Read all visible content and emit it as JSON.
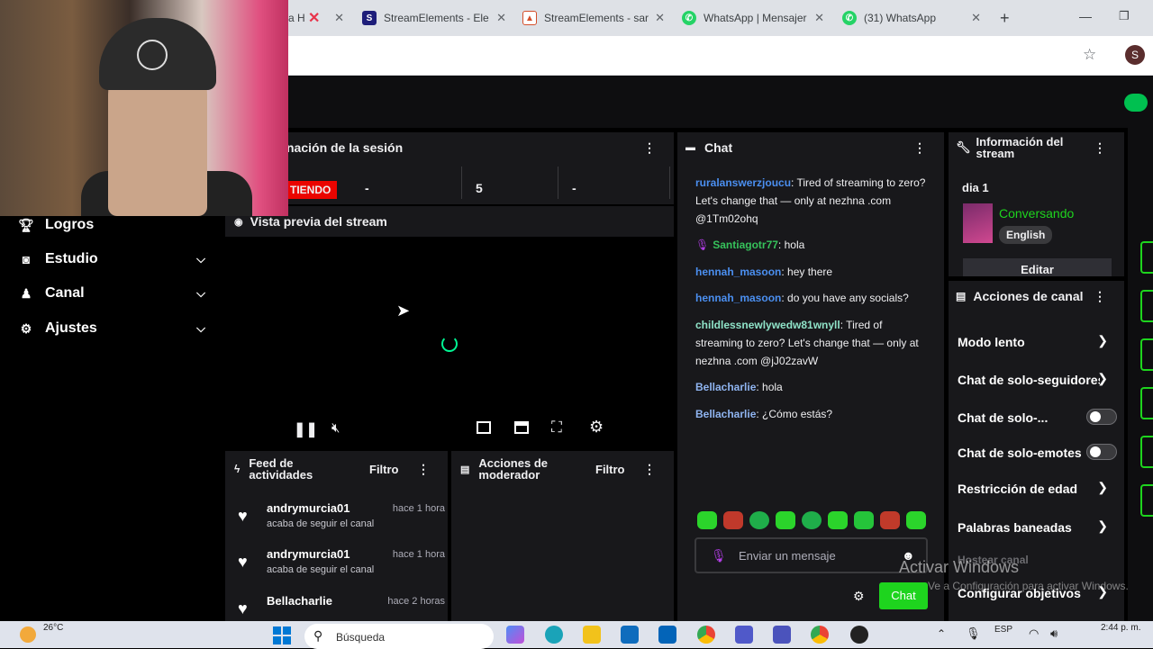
{
  "browser": {
    "tabs": [
      {
        "title": "a H",
        "icon": "red-x-icon",
        "color": "#e8334a"
      },
      {
        "title": "StreamElements - Ele",
        "icon": "streamelements-icon",
        "color": "#1e1e7a"
      },
      {
        "title": "StreamElements - sar",
        "icon": "streamelements-icon",
        "color": "#d44e2a"
      },
      {
        "title": "WhatsApp | Mensajer",
        "icon": "whatsapp-icon",
        "color": "#25d366"
      },
      {
        "title": "(31) WhatsApp",
        "icon": "whatsapp-icon",
        "color": "#25d366"
      }
    ],
    "profile_initial": "S"
  },
  "sidebar": {
    "items": [
      {
        "label": "Logros",
        "icon": "trophy-icon"
      },
      {
        "label": "Estudio",
        "icon": "camera-icon"
      },
      {
        "label": "Canal",
        "icon": "user-icon"
      },
      {
        "label": "Ajustes",
        "icon": "gear-icon"
      }
    ]
  },
  "session": {
    "title": "nación de la sesión",
    "live_badge": "TIENDO",
    "stats": [
      "-",
      "5",
      "-"
    ]
  },
  "preview": {
    "title": "Vista previa del stream"
  },
  "feed": {
    "title": "Feed de actividades",
    "filter_label": "Filtro",
    "items": [
      {
        "name": "andrymurcia01",
        "time": "hace 1 hora",
        "desc": "acaba de seguir el canal"
      },
      {
        "name": "andrymurcia01",
        "time": "hace 1 hora",
        "desc": "acaba de seguir el canal"
      },
      {
        "name": "Bellacharlie",
        "time": "hace 2 horas",
        "desc": ""
      }
    ]
  },
  "mod": {
    "title": "Acciones de moderador",
    "filter_label": "Filtro"
  },
  "chat": {
    "title": "Chat",
    "messages": [
      {
        "user": "ruralanswerzjoucu",
        "color": "#4b8ff0",
        "text": ": Tired of streaming to zero? Let's change that — only at nezhna .com @1Tm02ohq"
      },
      {
        "user": "Santiagotr77",
        "color": "#36c25b",
        "text": ": hola"
      },
      {
        "user": "hennah_masoon",
        "color": "#4b8ff0",
        "text": ": hey there"
      },
      {
        "user": "hennah_masoon",
        "color": "#4b8ff0",
        "text": ": do you have any socials?"
      },
      {
        "user": "childlessnewlywedw81wnyll",
        "color": "#8fe3c8",
        "text": ": Tired of streaming to zero? Let's change that — only at nezhna .com @jJ02zavW"
      },
      {
        "user": "Bellacharlie",
        "color": "#8fb4f0",
        "text": ": hola"
      },
      {
        "user": "Bellacharlie",
        "color": "#8fb4f0",
        "text": ": ¿Cómo estás?"
      }
    ],
    "input_placeholder": "Enviar un mensaje",
    "send_label": "Chat"
  },
  "stream_info": {
    "title": "Información del stream",
    "stream_title": "dia 1",
    "category": "Conversando",
    "language": "English",
    "edit_label": "Editar"
  },
  "channel_actions": {
    "title": "Acciones de canal",
    "items": [
      {
        "label": "Modo lento",
        "control": "chevron"
      },
      {
        "label": "Chat de solo-seguidores",
        "control": "chevron"
      },
      {
        "label": "Chat de solo-...",
        "control": "toggle"
      },
      {
        "label": "Chat de solo-emotes",
        "control": "toggle"
      },
      {
        "label": "Restricción de edad",
        "control": "chevron"
      },
      {
        "label": "Palabras baneadas",
        "control": "chevron"
      },
      {
        "label": "Hostear canal",
        "control": "none"
      },
      {
        "label": "Configurar objetivos",
        "control": "chevron"
      }
    ]
  },
  "watermark": {
    "line1": "Activar Windows",
    "line2": "Ve a Configuración para activar Windows."
  },
  "taskbar": {
    "weather": "26°C",
    "search_placeholder": "Búsqueda",
    "language": "ESP",
    "time": "2:44 p. m."
  },
  "colors": {
    "accent": "#00f593",
    "live": "#eb0400",
    "panel": "#18181b",
    "send": "#1ed41e"
  }
}
